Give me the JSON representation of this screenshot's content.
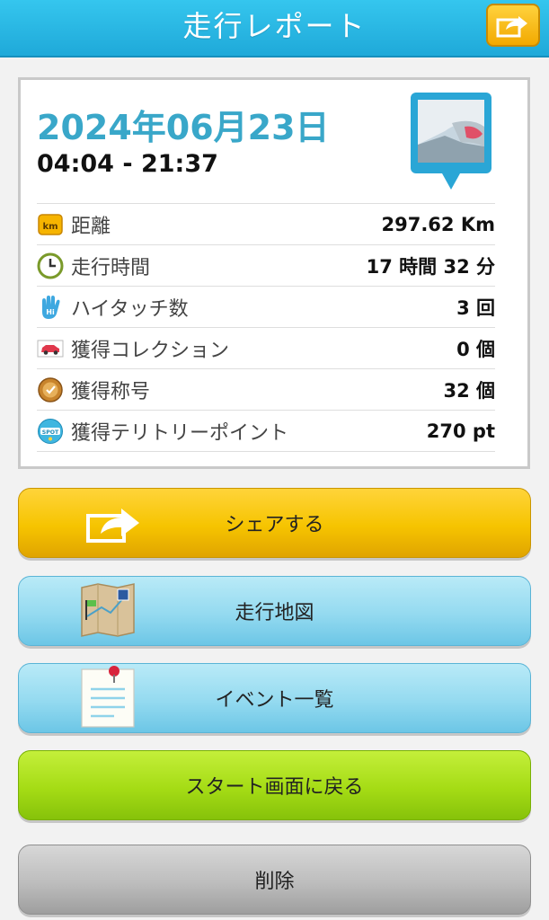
{
  "header": {
    "title": "走行レポート",
    "share_icon": "share-arrow-icon"
  },
  "report": {
    "date": "2024年06月23日",
    "time_range": "04:04 - 21:37",
    "rows": [
      {
        "icon": "km-icon",
        "label": "距離",
        "value": "297.62 Km"
      },
      {
        "icon": "clock-icon",
        "label": "走行時間",
        "value": "17 時間 32 分"
      },
      {
        "icon": "high-five-icon",
        "label": "ハイタッチ数",
        "value": "3 回"
      },
      {
        "icon": "car-icon",
        "label": "獲得コレクション",
        "value": "0 個"
      },
      {
        "icon": "medal-icon",
        "label": "獲得称号",
        "value": "32 個"
      },
      {
        "icon": "spot-icon",
        "label": "獲得テリトリーポイント",
        "value": "270 pt"
      }
    ]
  },
  "buttons": {
    "share": "シェアする",
    "map": "走行地図",
    "events": "イベント一覧",
    "back_to_start": "スタート画面に戻る",
    "delete": "削除"
  },
  "colors": {
    "header": "#1fa9d9",
    "date": "#39a7c9",
    "share_button": "#f6c400",
    "blue_button": "#94daf0",
    "green_button": "#a5dc15",
    "gray_button": "#bdbdbd"
  }
}
